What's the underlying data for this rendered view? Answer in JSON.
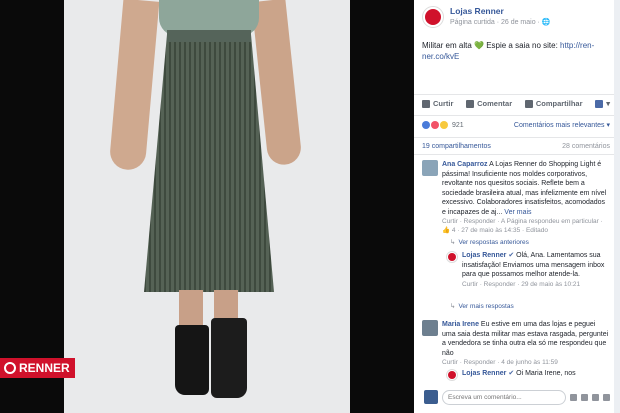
{
  "brand": {
    "logo_text": "RENNER"
  },
  "post": {
    "page_name": "Lojas Renner",
    "meta": "Página curtida · 26 de maio · ",
    "text": "Militar em alta 💚 Espie a saia no site: ",
    "link": "http://ren-ner.co/kvE"
  },
  "actions": {
    "like": "Curtir",
    "comment": "Comentar",
    "share": "Compartilhar"
  },
  "reactions": {
    "count": "921",
    "sort": "Comentários mais relevantes ▾"
  },
  "counts": {
    "shares": "19 compartilhamentos",
    "comments": "28 comentários"
  },
  "comments": [
    {
      "name": "Ana Caparroz",
      "text": "A Lojas Renner do Shopping Light é pássima! Insuficiente nos moldes corporativos, revoltante nos quesitos sociais. Reflete bem a sociedade brasileira atual, mas infelizmente em nível excessivo. Colaboradores insatisfeitos, acomodados e incapazes de aj...",
      "more": "Ver mais",
      "meta": "Curtir · Responder · A Página respondeu em particular · ",
      "meta2": "👍 4 · 27 de maio às 14:35 · Editado",
      "prev_replies": "Ver respostas anteriores",
      "reply": {
        "name": "Lojas Renner",
        "text": "Olá, Ana. Lamentamos sua insatisfação! Enviamos uma mensagem inbox para que possamos melhor atende-la.",
        "meta": "Curtir · Responder · 29 de maio às 10:21"
      },
      "more_replies": "Ver mais respostas"
    },
    {
      "name": "Maria Irene",
      "text": "Eu estive em uma das lojas e peguei uma saia desta militar mas estava rasgada, perguntei a vendedora se tinha outra ela só me respondeu que não",
      "meta": "Curtir · Responder · 4 de junho às 11:59",
      "reply": {
        "name": "Lojas Renner",
        "text": "Oi Maria Irene, nos"
      }
    }
  ],
  "composer": {
    "placeholder": "Escreva um comentário..."
  },
  "colors": {
    "brand_red": "#d0112b",
    "link_blue": "#365899"
  }
}
